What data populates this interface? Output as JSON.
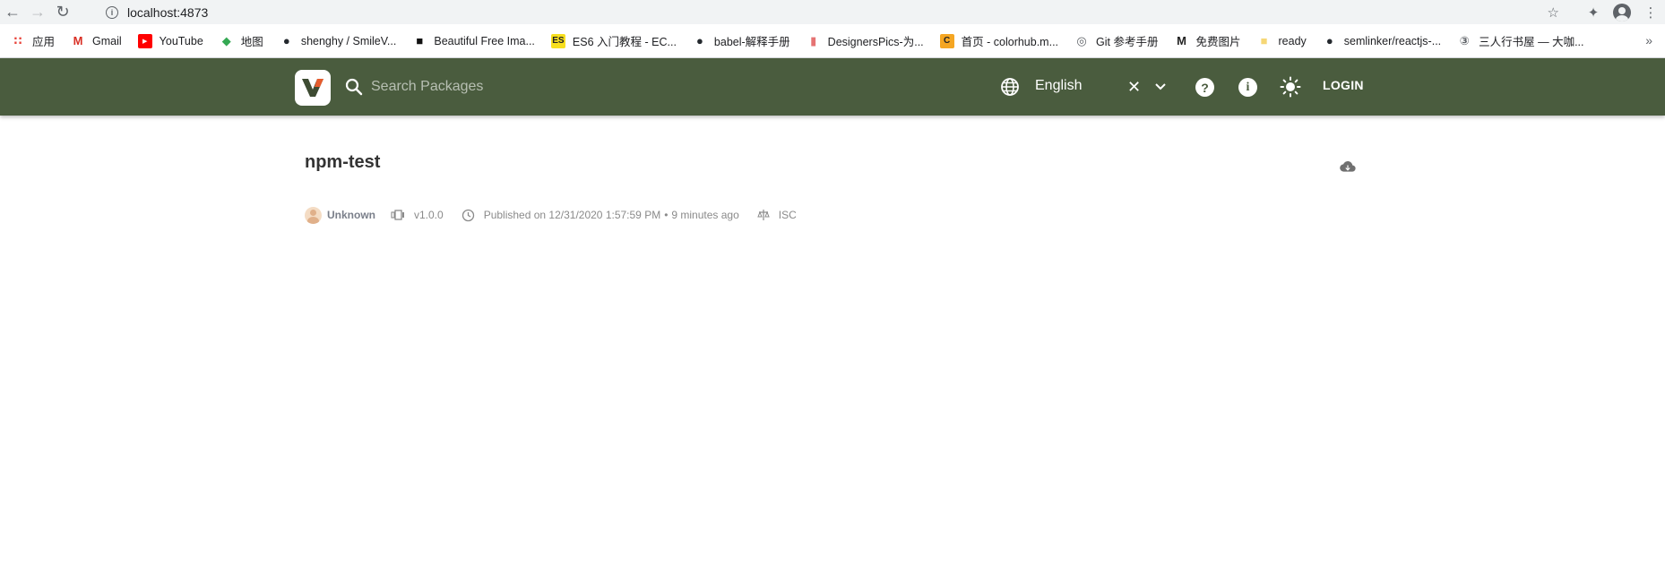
{
  "browser": {
    "url": "localhost:4873",
    "bookmarks": [
      {
        "label": "应用",
        "icon": "apps-grid-icon",
        "color": "#e8453c"
      },
      {
        "label": "Gmail",
        "icon": "gmail-icon",
        "color": "#d93025"
      },
      {
        "label": "YouTube",
        "icon": "youtube-icon",
        "color": "#ff0000"
      },
      {
        "label": "地图",
        "icon": "maps-icon",
        "color": "#34a853"
      },
      {
        "label": "shenghy / SmileV...",
        "icon": "github-icon",
        "color": "#24292e"
      },
      {
        "label": "Beautiful Free Ima...",
        "icon": "unsplash-icon",
        "color": "#111111"
      },
      {
        "label": "ES6 入门教程 - EC...",
        "icon": "es-icon",
        "color": "#f7df1e"
      },
      {
        "label": "babel-解释手册",
        "icon": "github-icon",
        "color": "#24292e"
      },
      {
        "label": "DesignersPics-为...",
        "icon": "bookmark-icon",
        "color": "#e57373"
      },
      {
        "label": "首页 - colorhub.m...",
        "icon": "colorhub-icon",
        "color": "#f5a623"
      },
      {
        "label": "Git 参考手册",
        "icon": "globe-icon",
        "color": "#5f6368"
      },
      {
        "label": "免费图片",
        "icon": "m-icon",
        "color": "#222222"
      },
      {
        "label": "ready",
        "icon": "folder-icon",
        "color": "#f6d776"
      },
      {
        "label": "semlinker/reactjs-...",
        "icon": "github-icon",
        "color": "#24292e"
      },
      {
        "label": "三人行书屋 — 大咖...",
        "icon": "circle-3-icon",
        "color": "#5f6368"
      }
    ]
  },
  "header": {
    "search_placeholder": "Search Packages",
    "language": "English",
    "login_label": "LOGIN",
    "background": "#4a5c3e"
  },
  "package": {
    "name": "npm-test",
    "author": "Unknown",
    "version": "v1.0.0",
    "published": "Published on 12/31/2020 1:57:59 PM",
    "published_ago": "9 minutes ago",
    "license": "ISC"
  }
}
